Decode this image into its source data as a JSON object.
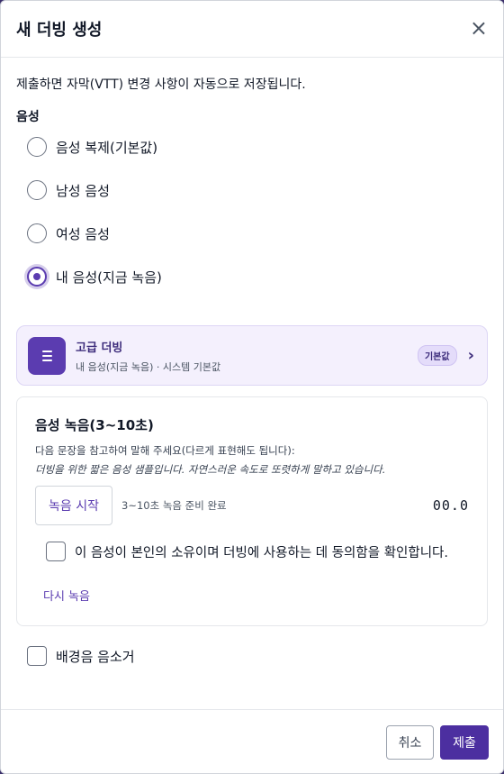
{
  "dialog": {
    "title": "새 더빙 생성",
    "close_glyph": "×",
    "notice": "제출하면 자막(VTT) 변경 사항이 자동으로 저장됩니다."
  },
  "voice": {
    "section_label": "음성",
    "options": [
      {
        "label": "음성 복제(기본값)",
        "checked": false
      },
      {
        "label": "남성 음성",
        "checked": false
      },
      {
        "label": "여성 음성",
        "checked": false
      },
      {
        "label": "내 음성(지금 녹음)",
        "checked": true
      }
    ]
  },
  "advanced": {
    "icon": "list-icon",
    "title": "고급 더빙",
    "subtitle": "내 음성(지금 녹음) · 시스템 기본값",
    "badge": "기본값",
    "chevron": "›"
  },
  "recording": {
    "title": "음성 녹음(3~10초)",
    "description": "다음 문장을 참고하여 말해 주세요(다르게 표현해도 됩니다):",
    "sample": "더빙을 위한 짧은 음성 샘플입니다. 자연스러운 속도로 또렷하게 말하고 있습니다.",
    "start_button": "녹음 시작",
    "status": "3~10초 녹음 준비 완료",
    "timer": "00.0",
    "consent": "이 음성이 본인의 소유이며 더빙에 사용하는 데 동의함을 확인합니다.",
    "consent_checked": false,
    "rerecord": "다시 녹음"
  },
  "background_removal": {
    "label": "배경음 음소거",
    "checked": false
  },
  "footer": {
    "cancel": "취소",
    "submit": "제출"
  },
  "colors": {
    "accent": "#5b3cb0",
    "submit": "#4c2fa0",
    "card_bg": "#f4f0fd"
  }
}
